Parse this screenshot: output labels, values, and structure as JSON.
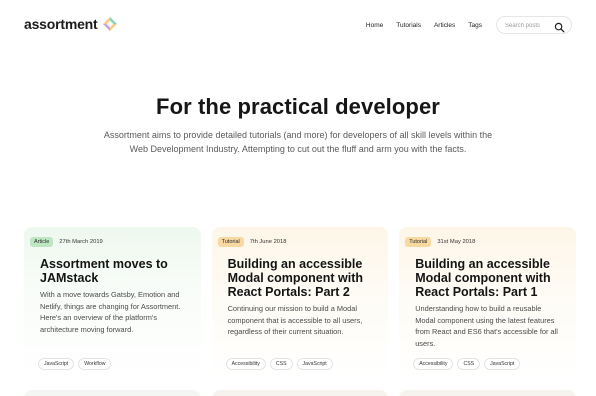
{
  "brand": {
    "name": "assortment",
    "logo_icon": "prism-logo-icon"
  },
  "nav": {
    "links": [
      "Home",
      "Tutorials",
      "Articles",
      "Tags"
    ],
    "search": {
      "placeholder": "Search posts",
      "icon": "search-icon"
    }
  },
  "hero": {
    "title": "For the practical developer",
    "subtitle": "Assortment aims to provide detailed tutorials (and more) for developers of all skill levels within the Web Development Industry. Attempting to cut out the fluff and arm you with the facts."
  },
  "cards": [
    {
      "type": "Article",
      "date": "27th March 2019",
      "title": "Assortment moves to JAMstack",
      "description": "With a move towards Gatsby, Emotion and Netlify, things are changing for Assortment. Here's an overview of the platform's architecture moving forward.",
      "tags": [
        "JavaScript",
        "Workflow"
      ],
      "accent": "#bfe6c2"
    },
    {
      "type": "Tutorial",
      "date": "7th June 2018",
      "title": "Building an accessible Modal component with React Portals: Part 2",
      "description": "Continuing our mission to build a Modal component that is accessible to all users, regardless of their current situation.",
      "tags": [
        "Accessibility",
        "CSS",
        "JavaScript"
      ],
      "accent": "#f8d9a2"
    },
    {
      "type": "Tutorial",
      "date": "31st May 2018",
      "title": "Building an accessible Modal component with React Portals: Part 1",
      "description": "Understanding how to build a reusable Modal component using the latest features from React and ES6 that's accessible for all users.",
      "tags": [
        "Accessibility",
        "CSS",
        "JavaScript"
      ],
      "accent": "#f8d9a2"
    }
  ]
}
